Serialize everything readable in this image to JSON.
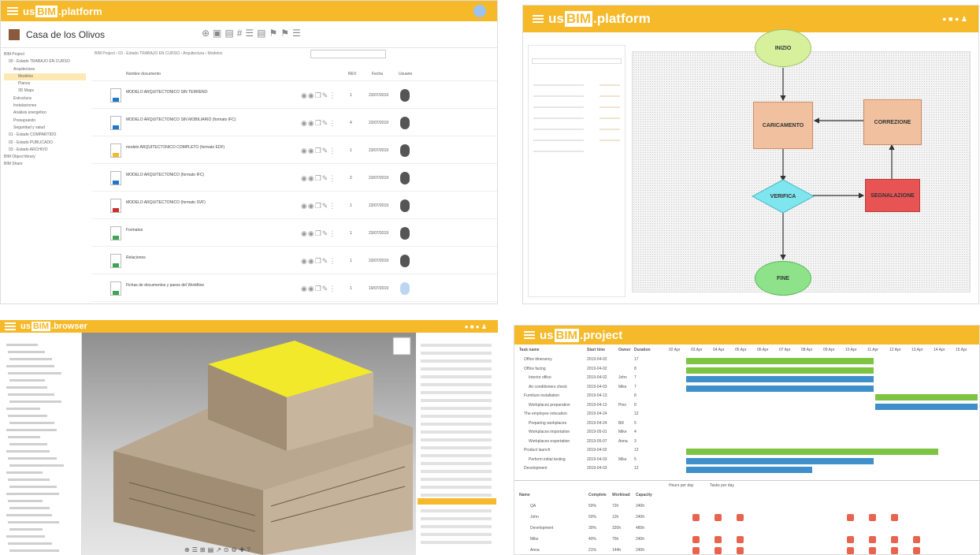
{
  "colors": {
    "brand": "#f5b929",
    "green": "#7dc443",
    "blue": "#3f8fcb",
    "start": "#d7f09c",
    "task": "#f1c19f",
    "decision": "#7fe6ef",
    "alert": "#e85454"
  },
  "p1": {
    "logo": {
      "us": "us",
      "bim": "BIM",
      "suffix": ".platform"
    },
    "project": "Casa de los Olivos",
    "breadcrumb": "BIM Project › 03 - Estado TRABAJO EN CURSO › Arquitectura › Modelos",
    "tree": [
      "BIM Project",
      "00 - Estado TRABAJO EN CURSO",
      "Arquitectura",
      "Modelos",
      "Planos",
      "3D Maps",
      "Estructura",
      "Instalaciones",
      "Análisis energético",
      "Presupuesto",
      "Seguridad y salud",
      "01 - Estado COMPARTIDO",
      "02 - Estado PUBLICADO",
      "03 - Estado ARCHIVO",
      "BIM Object library",
      "BIM Share"
    ],
    "columns": {
      "name": "Nombre documento",
      "rev": "REV",
      "date": "Fecha",
      "user": "Usuario"
    },
    "rows": [
      {
        "name": "MODELO ARQUITECTÓNICO SIN TERRENO",
        "rev": "1",
        "date": "23/07/2019",
        "color": "#1f77c9"
      },
      {
        "name": "MODELO ARQUITECTÓNICO SIN MOBILIARIO (formato IFC)",
        "rev": "4",
        "date": "23/07/2019",
        "color": "#1f77c9"
      },
      {
        "name": "modelo ARQUITECTÓNICO COMPLETO (formato EDF)",
        "rev": "1",
        "date": "23/07/2019",
        "color": "#f5b929"
      },
      {
        "name": "MODELO ARQUITECTÓNICO (formato IFC)",
        "rev": "2",
        "date": "23/07/2019",
        "color": "#1f77c9"
      },
      {
        "name": "MODELO ARQUITECTÓNICO (formato SVF)",
        "rev": "1",
        "date": "23/07/2019",
        "color": "#c9302c"
      },
      {
        "name": "Formatos",
        "rev": "1",
        "date": "23/07/2019",
        "color": "#3aa655"
      },
      {
        "name": "Relaciones",
        "rev": "1",
        "date": "23/07/2019",
        "color": "#3aa655"
      },
      {
        "name": "Fichas de documentos y pasos del Workflow",
        "rev": "1",
        "date": "19/07/2019",
        "color": "#3aa655"
      }
    ]
  },
  "p2": {
    "logo": {
      "us": "us",
      "bim": "BIM",
      "suffix": ".platform"
    },
    "nodes": {
      "start": "INIZIO",
      "load": "CARICAMENTO",
      "fix": "CORREZIONE",
      "check": "VERIFICA",
      "report": "SEGNALAZIONE",
      "end": "FINE"
    }
  },
  "p3": {
    "logo": {
      "us": "us",
      "bim": "BIM",
      "suffix": ".browser"
    }
  },
  "p4": {
    "logo": {
      "us": "us",
      "bim": "BIM",
      "suffix": ".project"
    },
    "cols": [
      "Task name",
      "Start time",
      "Owner",
      "Duration"
    ],
    "days": [
      "02 Apr",
      "03 Apr",
      "04 Apr",
      "05 Apr",
      "06 Apr",
      "07 Apr",
      "08 Apr",
      "09 Apr",
      "10 Apr",
      "11 Apr",
      "12 Apr",
      "13 Apr",
      "14 Apr",
      "15 Apr"
    ],
    "tasks": [
      [
        "Office itinerancy",
        "2019-04-02",
        "",
        "17"
      ],
      [
        "Office facing",
        "2019-04-02",
        "",
        "8"
      ],
      [
        "Interior office",
        "2019-04-02",
        "John",
        "7"
      ],
      [
        "Air conditioners check",
        "2019-04-03",
        "Mike",
        "7"
      ],
      [
        "Furniture installation",
        "2019-04-13",
        "",
        "8"
      ],
      [
        "Workplaces preparation",
        "2019-04-13",
        "Pino",
        "8"
      ],
      [
        "The employee relocation",
        "2019-04-24",
        "",
        "12"
      ],
      [
        "Preparing workplaces",
        "2019-04-24",
        "Bill",
        "5"
      ],
      [
        "Workplaces importation",
        "2019-05-01",
        "Mike",
        "4"
      ],
      [
        "Workplaces exportation",
        "2019-05-07",
        "Anna",
        "3"
      ],
      [
        "Product launch",
        "2019-04-02",
        "",
        "12"
      ],
      [
        "Perform initial testing",
        "2019-04-03",
        "Mike",
        "5"
      ],
      [
        "Development",
        "2019-04-03",
        "",
        "12"
      ]
    ],
    "res_cols": [
      "Name",
      "Complete",
      "Workload",
      "Capacity"
    ],
    "res": [
      [
        "QA",
        "50%",
        "72h",
        "240h"
      ],
      [
        "John",
        "50%",
        "12h",
        "240h"
      ],
      [
        "Development",
        "30%",
        "320h",
        "480h"
      ],
      [
        "Mike",
        "40%",
        "75h",
        "240h"
      ],
      [
        "Anna",
        "21%",
        "144h",
        "240h"
      ]
    ],
    "filters": [
      "Hours per day",
      "Tasks per day"
    ]
  }
}
